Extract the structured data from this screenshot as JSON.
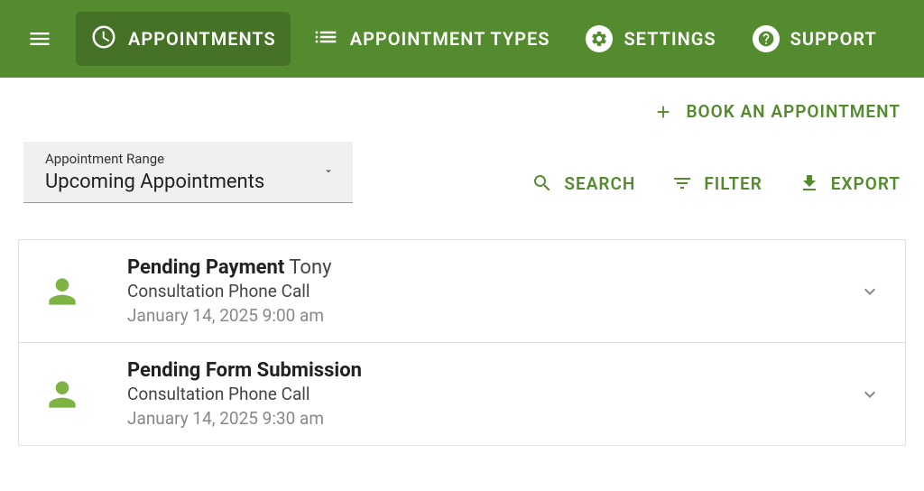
{
  "header": {
    "nav": [
      {
        "label": "APPOINTMENTS",
        "active": true,
        "icon": "clock"
      },
      {
        "label": "APPOINTMENT TYPES",
        "active": false,
        "icon": "list"
      },
      {
        "label": "SETTINGS",
        "active": false,
        "icon": "gear"
      },
      {
        "label": "SUPPORT",
        "active": false,
        "icon": "help"
      }
    ]
  },
  "toolbar": {
    "book_label": "BOOK AN APPOINTMENT"
  },
  "filter": {
    "range_label": "Appointment Range",
    "range_value": "Upcoming Appointments"
  },
  "actions": {
    "search": "SEARCH",
    "filter": "FILTER",
    "export": "EXPORT"
  },
  "appointments": [
    {
      "status": "Pending Payment",
      "name": "Tony",
      "type": "Consultation Phone Call",
      "date": "January 14, 2025 9:00 am"
    },
    {
      "status": "Pending Form Submission",
      "name": "",
      "type": "Consultation Phone Call",
      "date": "January 14, 2025 9:30 am"
    }
  ]
}
